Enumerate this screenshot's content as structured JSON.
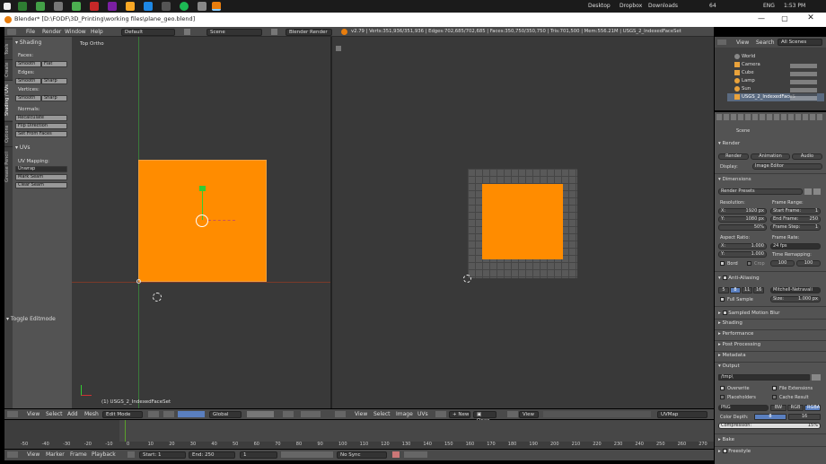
{
  "taskbar": {
    "desktop_label": "Desktop",
    "dropbox_label": "Dropbox",
    "downloads_label": "Downloads",
    "temp": "64",
    "lang": "ENG",
    "time": "1:53 PM"
  },
  "window": {
    "title": "Blender* [D:\\FODF\\3D_Printing\\working files\\plane_geo.blend]"
  },
  "infobar": {
    "menus": [
      "File",
      "Render",
      "Window",
      "Help"
    ],
    "layout": "Default",
    "scene": "Scene",
    "engine": "Blender Render",
    "stats": "v2.79 | Verts:351,936/351,936 | Edges:702,685/702,685 | Faces:350,750/350,750 | Tris:701,500 | Mem:556.21M | USGS_2_IndexedFaceSet"
  },
  "left_tabs": [
    "Tools",
    "Create",
    "Shading / UVs",
    "Options",
    "Grease Pencil"
  ],
  "toolshelf": {
    "shading_title": "Shading",
    "faces_label": "Faces:",
    "smooth": "Smooth",
    "flat": "Flat",
    "edges_label": "Edges:",
    "sharp": "Sharp",
    "vertices_label": "Vertices:",
    "normals_label": "Normals:",
    "recalculate": "Recalculate",
    "flip_direction": "Flip Direction",
    "set_from_faces": "Set From Faces",
    "uvs_title": "UVs",
    "uv_mapping_label": "UV Mapping:",
    "unwrap": "Unwrap",
    "mark_seam": "Mark Seam",
    "clear_seam": "Clear Seam",
    "toggle_editmode": "Toggle Editmode"
  },
  "viewport": {
    "view_label": "Top Ortho",
    "object_label": "(1) USGS_2_IndexedFaceSet"
  },
  "header3d": {
    "menus": [
      "View",
      "Select",
      "Add",
      "Mesh"
    ],
    "mode": "Edit Mode",
    "orientation": "Global"
  },
  "headeruv": {
    "menus": [
      "View",
      "Select",
      "Image",
      "UVs"
    ],
    "new_btn": "New",
    "open_btn": "Open",
    "view": "View",
    "uvmap": "UVMap"
  },
  "timeline": {
    "ticks": [
      "-50",
      "-40",
      "-30",
      "-20",
      "-10",
      "0",
      "10",
      "20",
      "30",
      "40",
      "50",
      "60",
      "70",
      "80",
      "90",
      "100",
      "110",
      "120",
      "130",
      "140",
      "150",
      "160",
      "170",
      "180",
      "190",
      "200",
      "210",
      "220",
      "230",
      "240",
      "250",
      "260",
      "270",
      "280"
    ],
    "menus": [
      "View",
      "Marker",
      "Frame",
      "Playback"
    ],
    "start": "Start:",
    "start_val": "1",
    "end": "End:",
    "end_val": "250",
    "current": "1",
    "sync": "No Sync"
  },
  "outliner": {
    "view": "View",
    "search": "Search",
    "all_scenes": "All Scenes",
    "items": [
      "World",
      "Camera",
      "Cube",
      "Lamp",
      "Sun",
      "USGS_2_IndexedFaceS"
    ]
  },
  "properties": {
    "scene_crumb": "Scene",
    "render_title": "Render",
    "render_btn": "Render",
    "animation_btn": "Animation",
    "audio_btn": "Audio",
    "display_label": "Display:",
    "display_val": "Image Editor",
    "dimensions_title": "Dimensions",
    "presets": "Render Presets",
    "resolution_label": "Resolution:",
    "res_x": "X:",
    "res_x_val": "1920 px",
    "res_y": "Y:",
    "res_y_val": "1080 px",
    "res_pct": "50%",
    "frame_range_label": "Frame Range:",
    "start_frame": "Start Frame:",
    "start_frame_val": "1",
    "end_frame": "End Frame:",
    "end_frame_val": "250",
    "frame_step": "Frame Step:",
    "frame_step_val": "1",
    "aspect_label": "Aspect Ratio:",
    "asp_x": "X:",
    "asp_x_val": "1.000",
    "asp_y": "Y:",
    "asp_y_val": "1.000",
    "frame_rate_label": "Frame Rate:",
    "fps": "24 fps",
    "time_remap_label": "Time Remapping:",
    "remap_old": "100",
    "remap_new": "100",
    "bord": "Bord",
    "crop": "Crop",
    "aa_title": "Anti-Aliasing",
    "aa_samples": [
      "5",
      "8",
      "11",
      "16"
    ],
    "aa_filter": "Mitchell-Netravali",
    "full_sample": "Full Sample",
    "size_label": "Size:",
    "size_val": "1.000 px",
    "smb_title": "Sampled Motion Blur",
    "shading_title": "Shading",
    "performance_title": "Performance",
    "post_title": "Post Processing",
    "metadata_title": "Metadata",
    "output_title": "Output",
    "output_path": "/tmp\\",
    "overwrite": "Overwrite",
    "file_ext": "File Extensions",
    "placeholders": "Placeholders",
    "cache_result": "Cache Result",
    "format": "PNG",
    "bw": "BW",
    "rgb": "RGB",
    "rgba": "RGBA",
    "color_depth_label": "Color Depth:",
    "depth_8": "8",
    "depth_16": "16",
    "compression_label": "Compression:",
    "compression_val": "15%",
    "bake_title": "Bake",
    "freestyle_title": "Freestyle"
  }
}
